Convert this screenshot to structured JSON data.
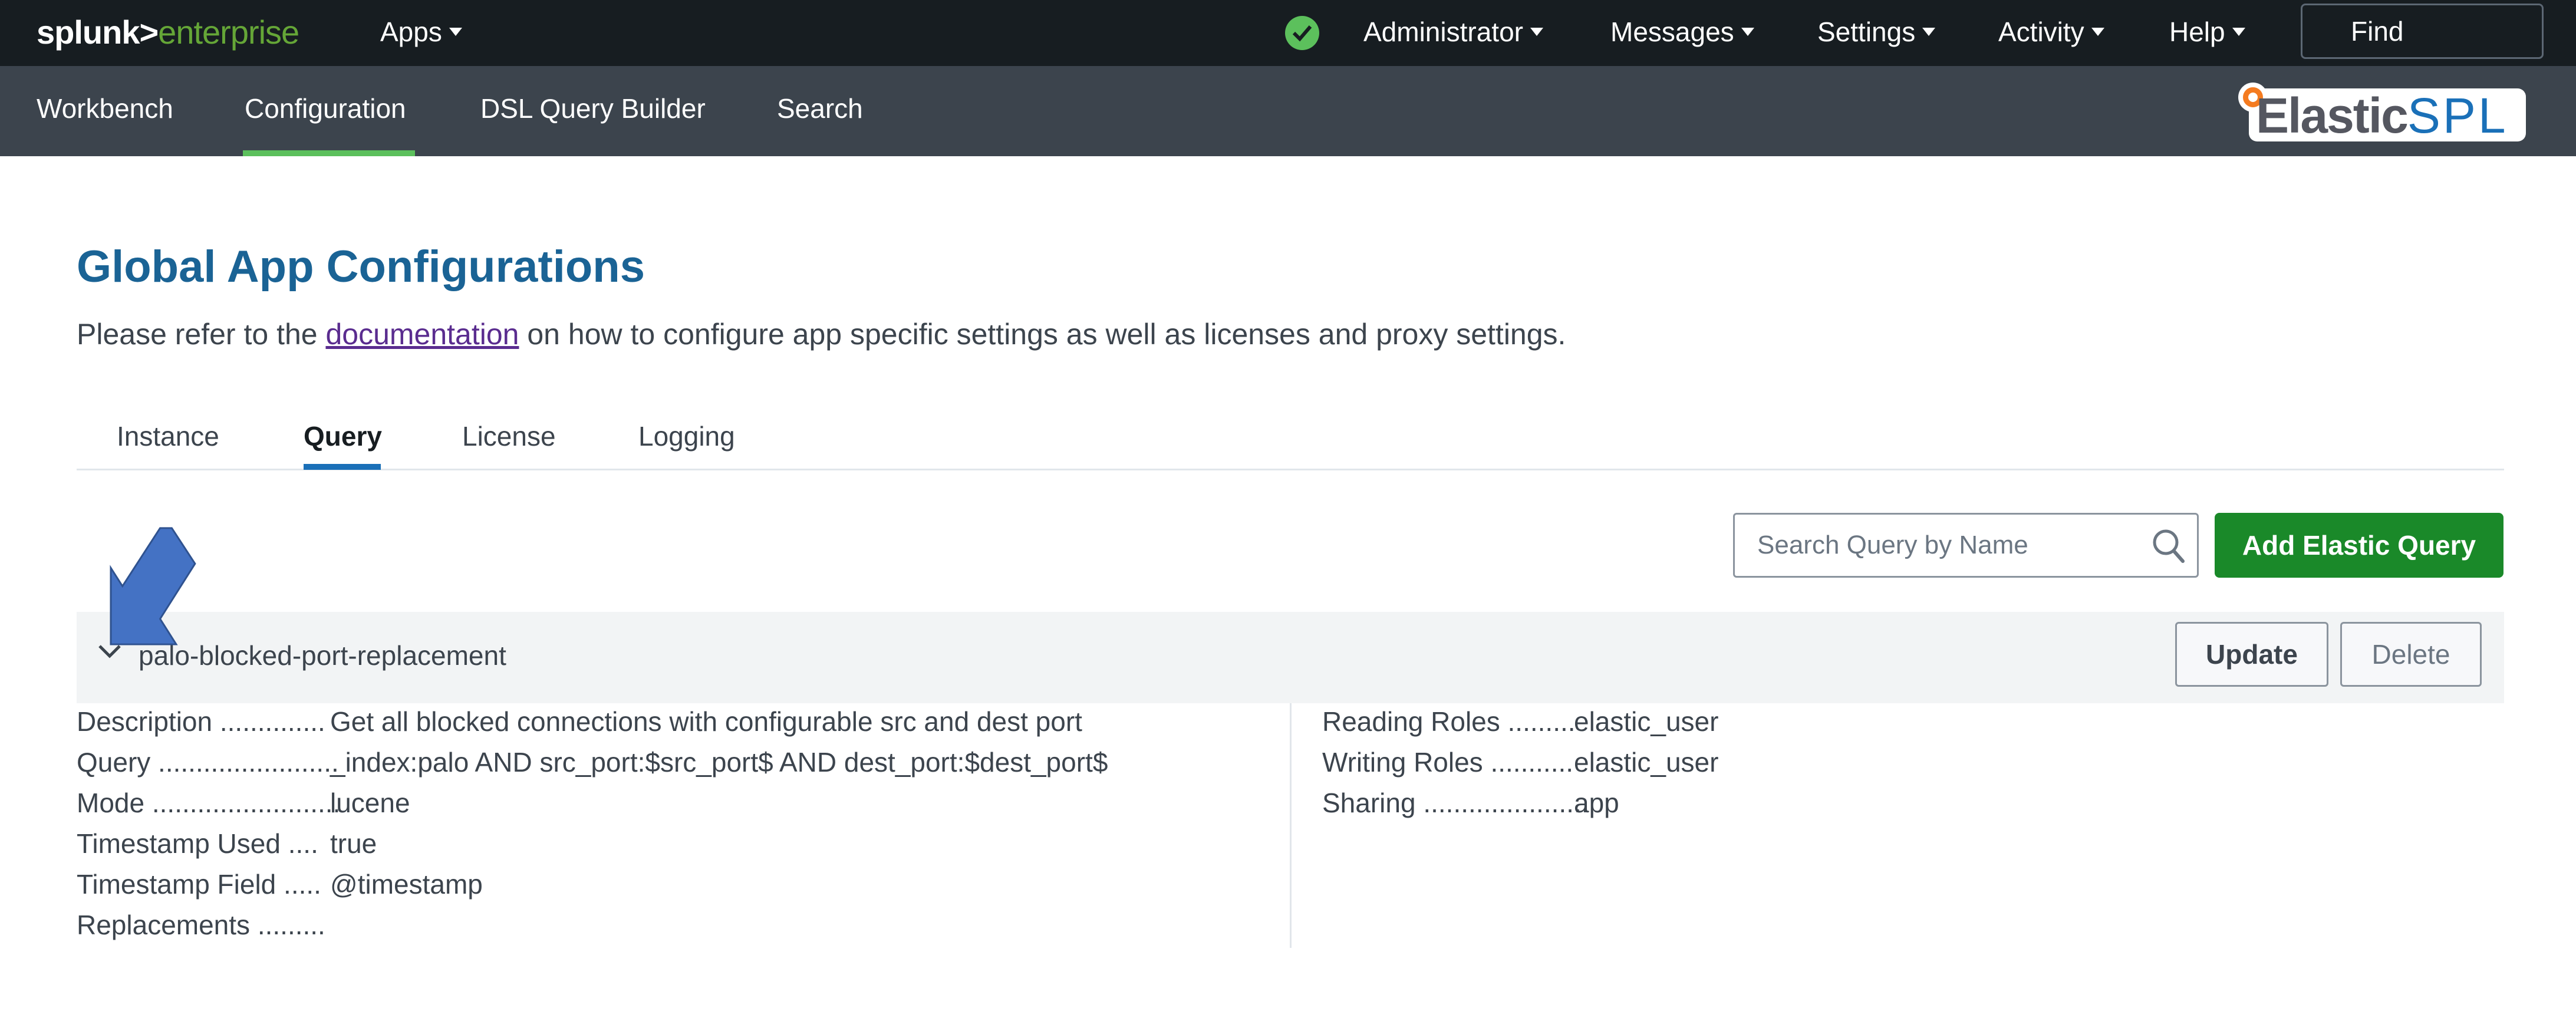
{
  "topbar": {
    "logo_primary": "splunk>",
    "logo_secondary": "enterprise",
    "apps_label": "Apps",
    "status_icon": "check-circle-icon",
    "menus": [
      {
        "label": "Administrator"
      },
      {
        "label": "Messages"
      },
      {
        "label": "Settings"
      },
      {
        "label": "Activity"
      },
      {
        "label": "Help"
      }
    ],
    "find_label": "Find"
  },
  "appbar": {
    "items": [
      {
        "label": "Workbench",
        "active": false
      },
      {
        "label": "Configuration",
        "active": true
      },
      {
        "label": "DSL Query Builder",
        "active": false
      },
      {
        "label": "Search",
        "active": false
      }
    ],
    "app_logo_part1": "Elastic",
    "app_logo_part2": "SPL",
    "active_color": "#5cc05c"
  },
  "main": {
    "title": "Global App Configurations",
    "intro_before": "Please refer to the ",
    "intro_link": "documentation",
    "intro_after": " on how to configure app specific settings as well as licenses and proxy settings.",
    "tabs": [
      {
        "label": "Instance",
        "active": false
      },
      {
        "label": "Query",
        "active": true
      },
      {
        "label": "License",
        "active": false
      },
      {
        "label": "Logging",
        "active": false
      }
    ],
    "search_placeholder": "Search Query by Name",
    "add_button": "Add Elastic Query",
    "add_button_color": "#1a8929"
  },
  "query": {
    "name": "palo-blocked-port-replacement",
    "expanded": true,
    "update_label": "Update",
    "delete_label": "Delete",
    "left_fields": [
      {
        "key": "Description ..............",
        "value": "Get all blocked connections with configurable src and dest port"
      },
      {
        "key": "Query ........................",
        "value": "_index:palo AND src_port:$src_port$ AND dest_port:$dest_port$"
      },
      {
        "key": "Mode .........................",
        "value": "lucene"
      },
      {
        "key": "Timestamp Used ....",
        "value": "true"
      },
      {
        "key": "Timestamp Field .....",
        "value": "@timestamp"
      },
      {
        "key": "Replacements .........",
        "value": ""
      }
    ],
    "right_fields": [
      {
        "key": "Reading Roles .........",
        "value": "elastic_user"
      },
      {
        "key": "Writing Roles ...........",
        "value": "elastic_user"
      },
      {
        "key": "Sharing ......................",
        "value": "app"
      }
    ]
  },
  "annotation": {
    "icon": "arrow-down-left-icon",
    "color": "#4472c4"
  }
}
